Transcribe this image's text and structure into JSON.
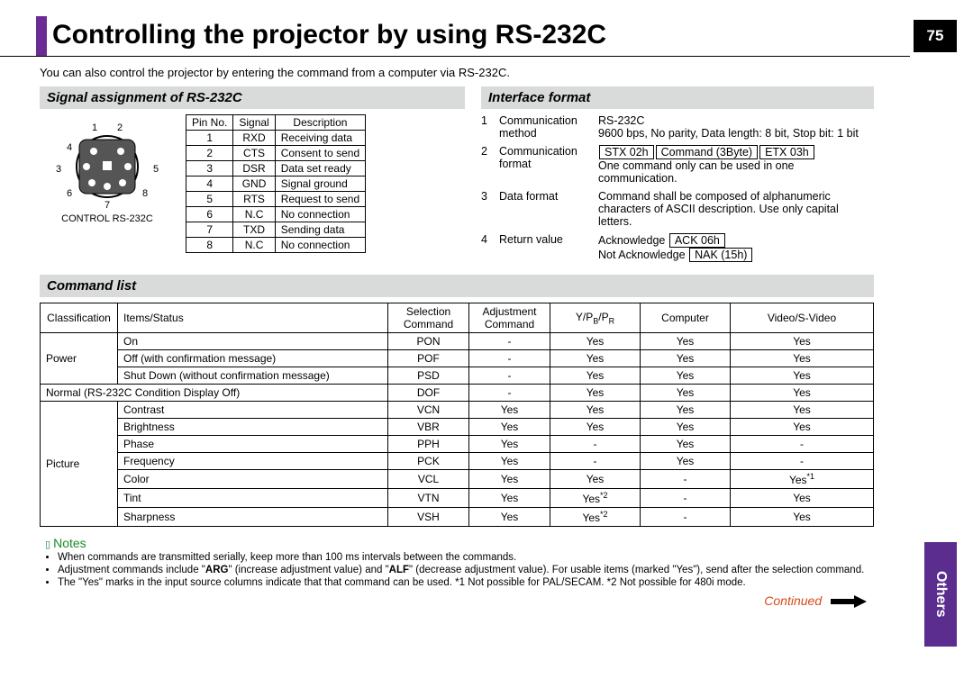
{
  "page_number": "75",
  "title": "Controlling the projector by using RS-232C",
  "intro": "You can also control the projector by entering the command from a computer via RS-232C.",
  "side_tab": "Others",
  "continued": "Continued",
  "signal": {
    "heading": "Signal assignment of RS-232C",
    "connector_label": "CONTROL RS-232C",
    "pin_nums": [
      "1",
      "2",
      "3",
      "4",
      "5",
      "6",
      "7",
      "8"
    ],
    "headers": [
      "Pin No.",
      "Signal",
      "Description"
    ],
    "rows": [
      [
        "1",
        "RXD",
        "Receiving data"
      ],
      [
        "2",
        "CTS",
        "Consent to send"
      ],
      [
        "3",
        "DSR",
        "Data set ready"
      ],
      [
        "4",
        "GND",
        "Signal ground"
      ],
      [
        "5",
        "RTS",
        "Request to send"
      ],
      [
        "6",
        "N.C",
        "No connection"
      ],
      [
        "7",
        "TXD",
        "Sending data"
      ],
      [
        "8",
        "N.C",
        "No connection"
      ]
    ]
  },
  "interface": {
    "heading": "Interface format",
    "rows": [
      {
        "n": "1",
        "k": "Communication method",
        "v_pre": "RS-232C",
        "v_post": "9600 bps, No parity, Data length: 8 bit, Stop bit: 1 bit"
      },
      {
        "n": "2",
        "k": "Communication format",
        "boxes": [
          "STX 02h",
          "Command (3Byte)",
          "ETX 03h"
        ],
        "v_post": "One command only can be used in one communication."
      },
      {
        "n": "3",
        "k": "Data format",
        "v_post": "Command shall be composed of alphanumeric characters of ASCII description. Use only capital letters."
      },
      {
        "n": "4",
        "k": "Return value",
        "ack_label": "Acknowledge",
        "ack_box": "ACK 06h",
        "nak_label": "Not Acknowledge",
        "nak_box": "NAK (15h)"
      }
    ]
  },
  "command": {
    "heading": "Command list",
    "headers": [
      "Classification",
      "Items/Status",
      "Selection Command",
      "Adjustment Command",
      "Y/PB/PR",
      "Computer",
      "Video/S-Video"
    ],
    "rows": [
      {
        "cls": "Power",
        "item": "On",
        "sc": "PON",
        "ac": "-",
        "y": "Yes",
        "c": "Yes",
        "v": "Yes",
        "cls_span": 3
      },
      {
        "item": "Off (with confirmation message)",
        "sc": "POF",
        "ac": "-",
        "y": "Yes",
        "c": "Yes",
        "v": "Yes"
      },
      {
        "item": "Shut Down (without confirmation message)",
        "sc": "PSD",
        "ac": "-",
        "y": "Yes",
        "c": "Yes",
        "v": "Yes"
      },
      {
        "full": "Normal (RS-232C Condition Display Off)",
        "sc": "DOF",
        "ac": "-",
        "y": "Yes",
        "c": "Yes",
        "v": "Yes"
      },
      {
        "cls": "Picture",
        "item": "Contrast",
        "sc": "VCN",
        "ac": "Yes",
        "y": "Yes",
        "c": "Yes",
        "v": "Yes",
        "cls_span": 7
      },
      {
        "item": "Brightness",
        "sc": "VBR",
        "ac": "Yes",
        "y": "Yes",
        "c": "Yes",
        "v": "Yes"
      },
      {
        "item": "Phase",
        "sc": "PPH",
        "ac": "Yes",
        "y": "-",
        "c": "Yes",
        "v": "-"
      },
      {
        "item": "Frequency",
        "sc": "PCK",
        "ac": "Yes",
        "y": "-",
        "c": "Yes",
        "v": "-"
      },
      {
        "item": "Color",
        "sc": "VCL",
        "ac": "Yes",
        "y": "Yes",
        "c": "-",
        "v": "Yes*1"
      },
      {
        "item": "Tint",
        "sc": "VTN",
        "ac": "Yes",
        "y": "Yes*2",
        "c": "-",
        "v": "Yes"
      },
      {
        "item": "Sharpness",
        "sc": "VSH",
        "ac": "Yes",
        "y": "Yes*2",
        "c": "-",
        "v": "Yes"
      }
    ]
  },
  "notes": {
    "heading": "Notes",
    "items": [
      "When commands are transmitted serially, keep more than 100 ms intervals between the commands.",
      "Adjustment commands include \"ARG\" (increase adjustment value) and \"ALF\" (decrease adjustment value).  For usable items (marked \"Yes\"), send after the selection command.",
      "The \"Yes\" marks in the input source columns indicate that that command can be used. *1 Not possible for PAL/SECAM. *2 Not possible for 480i mode."
    ]
  }
}
